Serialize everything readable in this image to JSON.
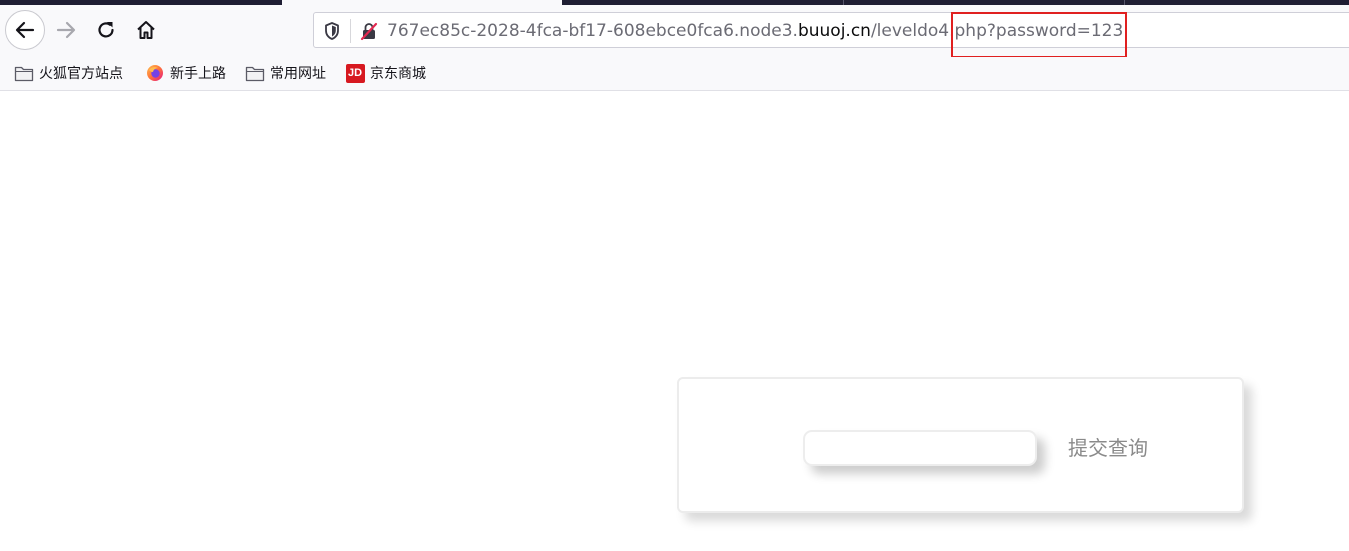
{
  "browser": {
    "url": {
      "prefix": "767ec85c-2028-4fca-bf17-608ebce0fca6.node3.",
      "host": "buuoj.cn",
      "path": "/leveldo4.php?password=123"
    },
    "bookmarks": [
      {
        "label": "火狐官方站点",
        "icon": "folder-icon"
      },
      {
        "label": "新手上路",
        "icon": "firefox-icon"
      },
      {
        "label": "常用网址",
        "icon": "folder-icon"
      },
      {
        "label": "京东商城",
        "icon": "jd-icon",
        "icon_text": "JD"
      }
    ],
    "highlight_color": "#e02020"
  },
  "page": {
    "password_input": {
      "value": "",
      "placeholder": ""
    },
    "submit_label": "提交查询"
  }
}
